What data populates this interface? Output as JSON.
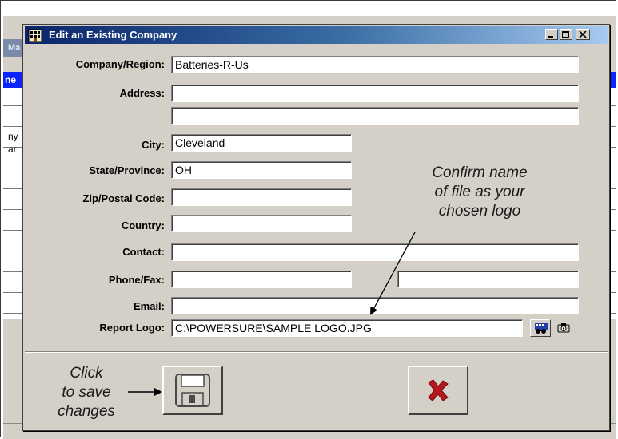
{
  "background": {
    "title_fragment": "Ma",
    "header_fragment": "ne",
    "row_fragments": [
      "ny",
      "ar"
    ]
  },
  "dialog": {
    "title": "Edit an Existing Company",
    "fields": {
      "company_region": {
        "label": "Company/Region:",
        "value": "Batteries-R-Us"
      },
      "address": {
        "label": "Address:",
        "value1": "",
        "value2": ""
      },
      "city": {
        "label": "City:",
        "value": "Cleveland"
      },
      "state_province": {
        "label": "State/Province:",
        "value": "OH"
      },
      "zip_postal": {
        "label": "Zip/Postal Code:",
        "value": ""
      },
      "country": {
        "label": "Country:",
        "value": ""
      },
      "contact": {
        "label": "Contact:",
        "value": ""
      },
      "phone_fax": {
        "label": "Phone/Fax:",
        "phone": "",
        "fax": ""
      },
      "email": {
        "label": "Email:",
        "value": ""
      },
      "report_logo": {
        "label": "Report Logo:",
        "value": "C:\\POWERSURE\\SAMPLE LOGO.JPG"
      }
    }
  },
  "annotations": {
    "confirm": [
      "Confirm name",
      "of file as your",
      "chosen logo"
    ],
    "save": [
      "Click",
      "to save",
      "changes"
    ]
  },
  "icons": {
    "title": "building-icon",
    "browse": "binoculars-icon",
    "camera": "camera-icon",
    "save": "floppy-disk-icon",
    "cancel": "red-x-icon"
  },
  "colors": {
    "title_gradient_start": "#0a246a",
    "title_gradient_end": "#a6caf0",
    "dialog_face": "#d4d0c8",
    "background_header_blue": "#0b24fb",
    "cancel_red": "#b8161c"
  }
}
